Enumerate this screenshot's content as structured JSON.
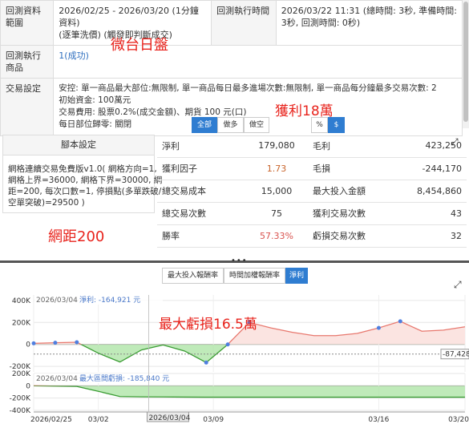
{
  "info": {
    "range_label": "回測資料範圍",
    "range_value_1": "2026/02/25 - 2026/03/20 (1分鐘資料)",
    "range_value_2": "(逐筆洗價) (觸發即判斷成交)",
    "time_label": "回測執行時間",
    "time_value_1": "2026/03/22 11:31 (總時間: 3秒, 準備時間:",
    "time_value_2": "3秒, 回測時間: 0秒)",
    "product_label": "回測執行商品",
    "product_value": "1(成功)",
    "settings_label": "交易設定",
    "settings_lines": [
      "安控: 單一商品最大部位:無限制, 單一商品每日最多進場次數:無限制, 單一商品每分鐘最多交易次數: 2",
      "初始資金: 100萬元",
      "交易費用: 股票0.2%(成交金額)、期貨 100 元(口)",
      "每日部位歸零: 關閉"
    ]
  },
  "annotations": {
    "product": "微台日盤",
    "profit": "獲利18萬",
    "grid": "網距200",
    "drawdown": "最大虧損16.5萬"
  },
  "toggles": {
    "direction": [
      "全部",
      "做多",
      "做空"
    ],
    "direction_active": 0,
    "unit": [
      "%",
      "$"
    ],
    "unit_active": 1
  },
  "script": {
    "header": "腳本設定",
    "lines": [
      "網格連續交易免費版v1.0( 網格方向=1,",
      "網格上界=36000, 網格下界=30000, 網",
      "距=200, 每次口數=1, 停損點(多單跌破/",
      "空單突破)=29500 )"
    ]
  },
  "stats": [
    {
      "l1": "淨利",
      "v1": "179,080",
      "l2": "毛利",
      "v2": "423,250",
      "c1": ""
    },
    {
      "l1": "獲利因子",
      "v1": "1.73",
      "l2": "毛損",
      "v2": "-244,170",
      "c1": "orange"
    },
    {
      "l1": "總交易成本",
      "v1": "15,000",
      "l2": "最大投入金額",
      "v2": "8,454,860",
      "c1": ""
    },
    {
      "l1": "總交易次數",
      "v1": "75",
      "l2": "獲利交易次數",
      "v2": "43",
      "c1": ""
    },
    {
      "l1": "勝率",
      "v1": "57.33%",
      "l2": "虧損交易次數",
      "v2": "32",
      "c1": "red"
    }
  ],
  "chart_tabs": [
    "最大投入報酬率",
    "時間加權報酬率",
    "淨利"
  ],
  "chart_tab_active": 2,
  "chart_data": [
    {
      "type": "area",
      "tooltip_date": "2026/03/04",
      "tooltip_series": "淨利",
      "tooltip_value": "-164,921 元",
      "y_ticks": [
        "400K",
        "200K",
        "0",
        "-200K"
      ],
      "ylim": [
        -250000,
        450000
      ],
      "last_value_label": "-87,428",
      "x": [
        0,
        3,
        6,
        9,
        12,
        15,
        18,
        21,
        24,
        27,
        30,
        33,
        36,
        39,
        42,
        45,
        48,
        51,
        54,
        57,
        60
      ],
      "values": [
        10000,
        15000,
        20000,
        -80000,
        -160000,
        -50000,
        -5000,
        -60000,
        -165000,
        0,
        200000,
        150000,
        110000,
        80000,
        80000,
        100000,
        150000,
        210000,
        120000,
        130000,
        160000
      ]
    },
    {
      "type": "area",
      "tooltip_date": "2026/03/04",
      "tooltip_series": "最大區間虧損",
      "tooltip_value": "-185,840 元",
      "y_ticks": [
        "200K",
        "0",
        "-200K",
        "-400K"
      ],
      "ylim": [
        -400000,
        200000
      ],
      "x": [
        0,
        3,
        6,
        9,
        12,
        15,
        18,
        21,
        24,
        27,
        30,
        33,
        36,
        39,
        42,
        45,
        48,
        51,
        54,
        57,
        60
      ],
      "values": [
        0,
        -5000,
        -10000,
        -90000,
        -175000,
        -180000,
        -182000,
        -184000,
        -185840,
        -185840,
        -185840,
        -185840,
        -185840,
        -185840,
        -185840,
        -185840,
        -185840,
        -185840,
        -185840,
        -185840,
        -185840
      ]
    }
  ],
  "x_axis_labels": [
    "2026/02/25",
    "03/02",
    "2026/03/04",
    "03/09",
    "03/16",
    "03/20"
  ],
  "colors": {
    "accent": "#2f7dd1",
    "annotation": "#e8231c",
    "positive_line": "#e8786e",
    "negative_fill": "#a9e3a2",
    "negative_line": "#3a9c33",
    "marker": "#4f7fe0"
  }
}
